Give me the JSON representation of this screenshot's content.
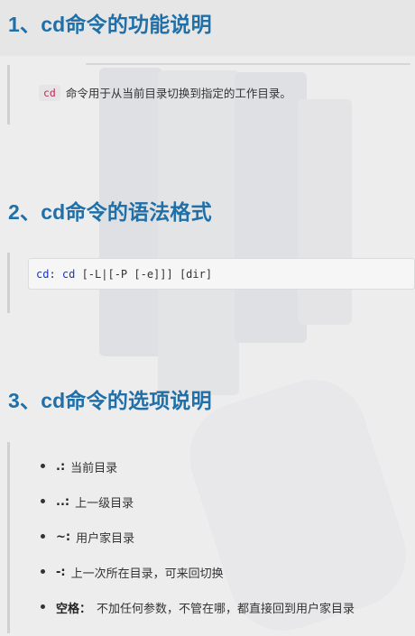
{
  "section1": {
    "title": "1、cd命令的功能说明",
    "code": "cd",
    "text": "命令用于从当前目录切换到指定的工作目录。"
  },
  "section2": {
    "title": "2、cd命令的语法格式",
    "syntax": {
      "part1": "cd",
      "part2": ": ",
      "part3": "cd",
      "part4": " [-L|[-P [-e]]] [dir]"
    }
  },
  "section3": {
    "title": "3、cd命令的选项说明",
    "options": [
      {
        "opt": ".:",
        "desc": "当前目录"
      },
      {
        "opt": "..:",
        "desc": "上一级目录"
      },
      {
        "opt": "~:",
        "desc": "用户家目录"
      },
      {
        "opt": "-:",
        "desc": "上一次所在目录，可来回切换"
      },
      {
        "opt": "空格：",
        "desc": "不加任何参数，不管在哪，都直接回到用户家目录"
      }
    ]
  }
}
